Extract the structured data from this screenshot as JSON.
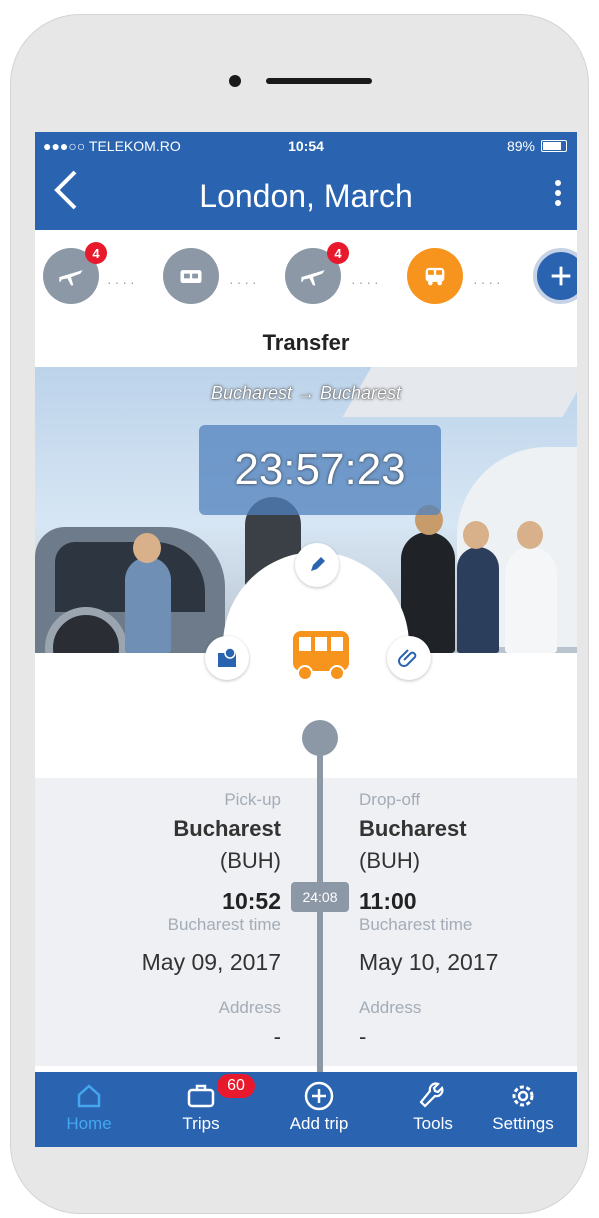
{
  "status_bar": {
    "carrier": "●●●○○ TELEKOM.RO",
    "time": "10:54",
    "battery": "89%"
  },
  "header": {
    "title": "London, March"
  },
  "steps": {
    "items": [
      {
        "icon": "airplane-icon",
        "badge": "4"
      },
      {
        "icon": "bed-icon",
        "badge": ""
      },
      {
        "icon": "airplane-icon",
        "badge": "4"
      },
      {
        "icon": "bus-icon",
        "badge": ""
      },
      {
        "icon": "plus-icon",
        "badge": ""
      }
    ]
  },
  "section": {
    "title": "Transfer"
  },
  "hero": {
    "route": "Bucharest → Bucharest",
    "countdown": "23:57:23"
  },
  "details": {
    "pickup": {
      "label": "Pick-up",
      "city": "Bucharest",
      "code": "(BUH)",
      "time": "10:52",
      "timezone": "Bucharest time",
      "date": "May 09, 2017",
      "address_label": "Address",
      "address": "-"
    },
    "dropoff": {
      "label": "Drop-off",
      "city": "Bucharest",
      "code": "(BUH)",
      "time": "11:00",
      "timezone": "Bucharest time",
      "date": "May 10, 2017",
      "address_label": "Address",
      "address": "-"
    },
    "duration": "24:08"
  },
  "tabbar": {
    "items": [
      {
        "label": "Home",
        "icon": "home-icon"
      },
      {
        "label": "Trips",
        "icon": "briefcase-icon",
        "badge": "60"
      },
      {
        "label": "Add trip",
        "icon": "plus-circle-icon"
      },
      {
        "label": "Tools",
        "icon": "wrench-icon"
      },
      {
        "label": "Settings",
        "icon": "gear-icon"
      }
    ]
  },
  "colors": {
    "primary": "#2a63b0",
    "accent": "#f7941d",
    "badge": "#e8192c",
    "step_inactive": "#8d98a7",
    "tab_active": "#44a7f0"
  }
}
